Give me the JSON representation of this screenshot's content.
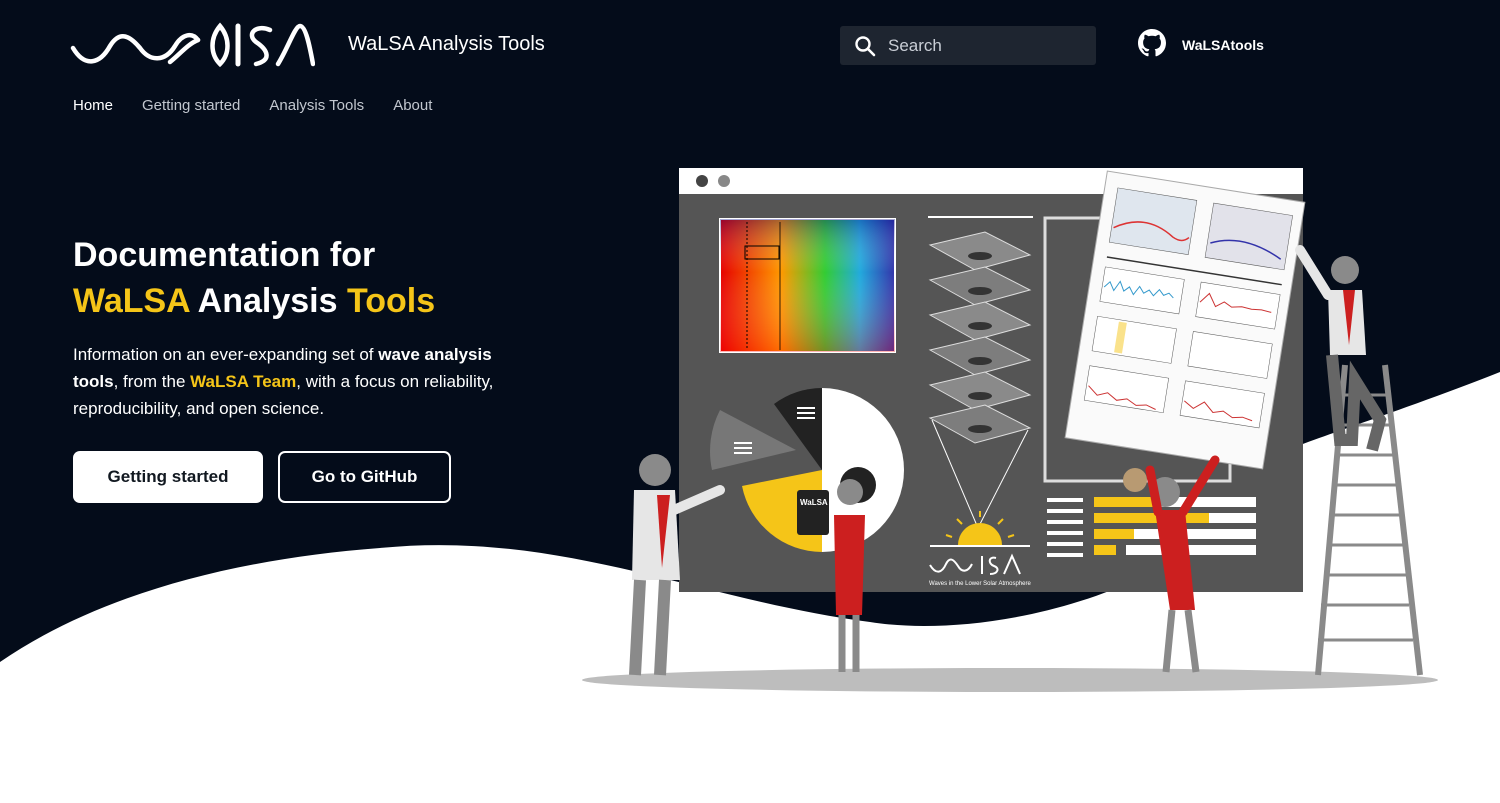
{
  "header": {
    "site_title": "WaLSA Analysis Tools",
    "search_placeholder": "Search",
    "github_label": "WaLSAtools",
    "logo_icon": "walsa-wave-logo"
  },
  "nav": {
    "items": [
      {
        "label": "Home",
        "active": true
      },
      {
        "label": "Getting started",
        "active": false
      },
      {
        "label": "Analysis Tools",
        "active": false
      },
      {
        "label": "About",
        "active": false
      }
    ]
  },
  "hero": {
    "headline_line1": "Documentation for",
    "headline_word1": "WaLSA",
    "headline_word2": " Analysis ",
    "headline_word3": "Tools",
    "desc_part1": "Information on an ever-expanding set of ",
    "desc_bold": "wave analysis tools",
    "desc_part2": ", from the ",
    "desc_accent": "WaLSA Team",
    "desc_part3": ", with a focus on reliability, reproducibility, and open science.",
    "primary_button": "Getting started",
    "secondary_button": "Go to GitHub"
  },
  "illustration": {
    "tablet_label": "WaLSA",
    "screen_logo_text": "Waves in the Lower Solar Atmosphere"
  },
  "colors": {
    "background": "#040c1a",
    "accent": "#f5c518",
    "screen": "#555555"
  }
}
